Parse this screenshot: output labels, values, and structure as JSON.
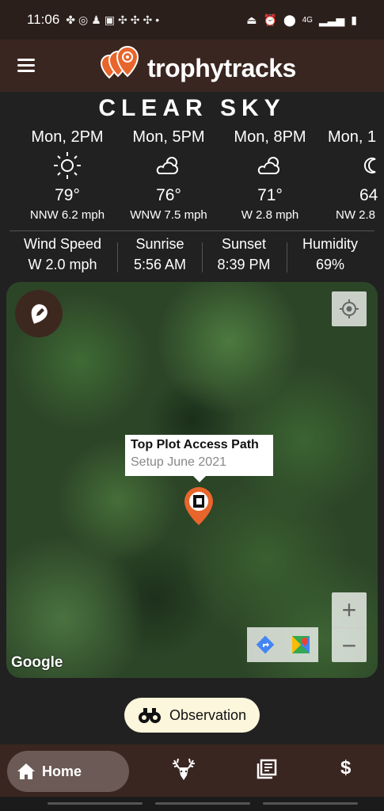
{
  "status": {
    "time": "11:06",
    "network": "4G"
  },
  "header": {
    "app_name": "trophytracks"
  },
  "weather": {
    "condition": "CLEAR SKY",
    "forecast": [
      {
        "time": "Mon, 2PM",
        "icon": "sun-icon",
        "temp": "79°",
        "wind": "NNW 6.2 mph"
      },
      {
        "time": "Mon, 5PM",
        "icon": "partly-cloudy-icon",
        "temp": "76°",
        "wind": "WNW 7.5 mph"
      },
      {
        "time": "Mon, 8PM",
        "icon": "partly-cloudy-icon",
        "temp": "71°",
        "wind": "W 2.8 mph"
      },
      {
        "time": "Mon, 1",
        "icon": "moon-icon",
        "temp": "64",
        "wind": "NW 2.8"
      }
    ],
    "stats": [
      {
        "label": "Wind Speed",
        "value": "W 2.0 mph"
      },
      {
        "label": "Sunrise",
        "value": "5:56 AM"
      },
      {
        "label": "Sunset",
        "value": "8:39 PM"
      },
      {
        "label": "Humidity",
        "value": "69%"
      }
    ]
  },
  "map": {
    "info_title": "Top Plot Access Path",
    "info_subtitle": "Setup June 2021",
    "attribution": "Google",
    "zoom_in": "+",
    "zoom_out": "−"
  },
  "observation_button": {
    "label": "Observation"
  },
  "bottom_nav": {
    "home_label": "Home",
    "currency_label": "$"
  },
  "colors": {
    "accent": "#e8652b",
    "header_bg": "#3a2620",
    "page_bg": "#212121",
    "obs_bg": "#fbf6dc"
  }
}
